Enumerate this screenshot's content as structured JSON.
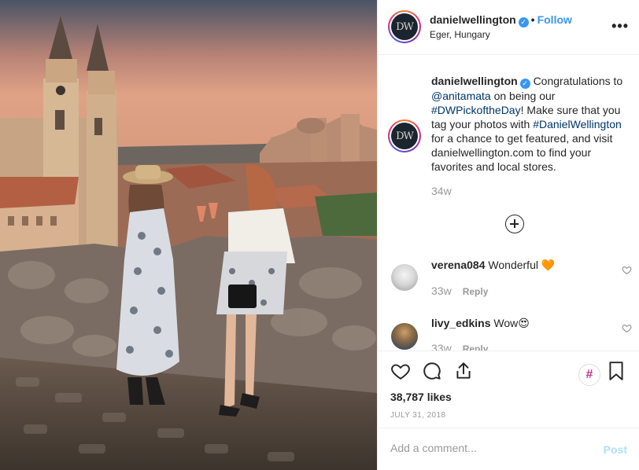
{
  "post": {
    "author": "danielwellington",
    "avatar_initials": "DW",
    "follow_label": "Follow",
    "separator": "•",
    "location": "Eger, Hungary",
    "more_label": "•••"
  },
  "caption": {
    "username": "danielwellington",
    "text_1": "Congratulations to",
    "mention": "@anitamata",
    "text_2": "on being our",
    "hashtag_1": "#DWPickoftheDay",
    "text_3": "! Make sure that you tag your photos with",
    "hashtag_2": "#DanielWellington",
    "text_4": "for a chance to get featured, and visit danielwellington.com to find your favorites and local stores.",
    "time": "34w"
  },
  "comments": [
    {
      "username": "verena084",
      "text": "Wonderful 🧡",
      "time": "33w",
      "reply_label": "Reply"
    },
    {
      "username": "livy_edkins",
      "text": "Wow😍",
      "time": "33w",
      "reply_label": "Reply"
    }
  ],
  "actions": {
    "hashtag_badge": "#",
    "likes": "38,787 likes",
    "date": "July 31, 2018"
  },
  "add_comment": {
    "placeholder": "Add a comment...",
    "post_label": "Post"
  },
  "colors": {
    "link": "#3897f0",
    "hashtag": "#003569",
    "muted": "#999999",
    "post_disabled": "#b2dffc"
  }
}
